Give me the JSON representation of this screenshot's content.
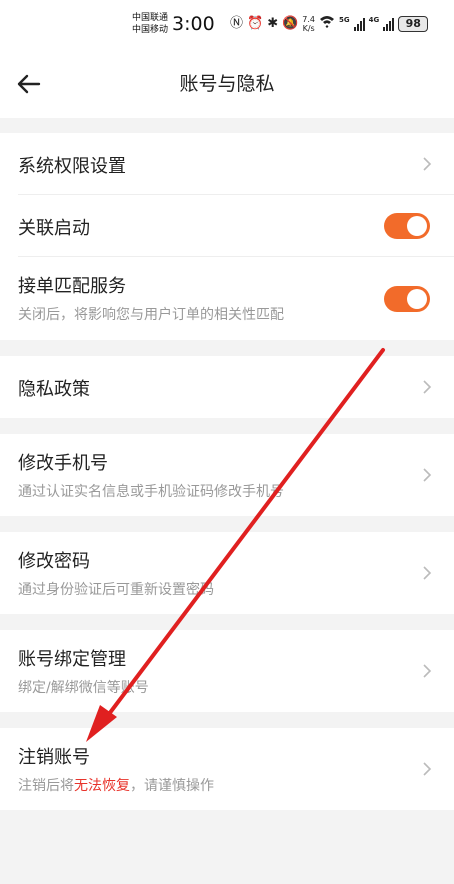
{
  "status": {
    "carrier1": "中国联通",
    "carrier2": "中国移动",
    "time": "3:00",
    "speed_value": "7.4",
    "speed_unit": "K/s",
    "net1": "5G",
    "net2": "4G",
    "battery": "98"
  },
  "header": {
    "title": "账号与隐私"
  },
  "colors": {
    "accent": "#f26b2a",
    "danger": "#e8332b"
  },
  "settings": {
    "permissions": {
      "label": "系统权限设置"
    },
    "linked_start": {
      "label": "关联启动",
      "enabled": true
    },
    "order_match": {
      "label": "接单匹配服务",
      "desc": "关闭后，将影响您与用户订单的相关性匹配",
      "enabled": true
    },
    "privacy_policy": {
      "label": "隐私政策"
    },
    "change_phone": {
      "label": "修改手机号",
      "desc": "通过认证实名信息或手机验证码修改手机号"
    },
    "change_password": {
      "label": "修改密码",
      "desc": "通过身份验证后可重新设置密码"
    },
    "account_binding": {
      "label": "账号绑定管理",
      "desc": "绑定/解绑微信等账号"
    },
    "cancel_account": {
      "label": "注销账号",
      "desc_prefix": "注销后将",
      "desc_warning": "无法恢复",
      "desc_suffix": "，请谨慎操作"
    }
  }
}
